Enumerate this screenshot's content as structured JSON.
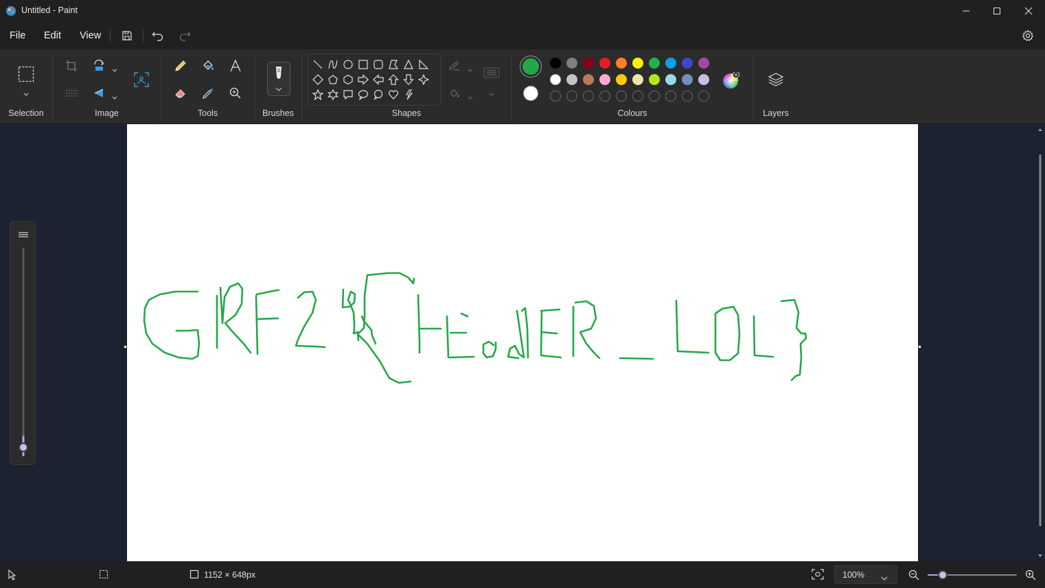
{
  "window": {
    "title": "Untitled - Paint"
  },
  "menu": {
    "file": "File",
    "edit": "Edit",
    "view": "View"
  },
  "ribbon": {
    "groups": {
      "selection": "Selection",
      "image": "Image",
      "tools": "Tools",
      "brushes": "Brushes",
      "shapes": "Shapes",
      "colours": "Colours",
      "layers": "Layers"
    },
    "primary_color": "#22a846",
    "secondary_color": "#ffffff",
    "palette_row1": [
      "#000000",
      "#7f7f7f",
      "#880015",
      "#ed1c24",
      "#ff7f27",
      "#fff200",
      "#22b14c",
      "#00a2e8",
      "#3f48cc",
      "#a349a4"
    ],
    "palette_row2": [
      "#ffffff",
      "#c3c3c3",
      "#b97a57",
      "#ffaec9",
      "#ffc90e",
      "#efe4b0",
      "#b5e61d",
      "#99d9ea",
      "#7092be",
      "#c8bfe7"
    ]
  },
  "canvas": {
    "drawing_color": "#22a846"
  },
  "status": {
    "canvas_size": "1152 × 648px",
    "zoom": "100%"
  }
}
